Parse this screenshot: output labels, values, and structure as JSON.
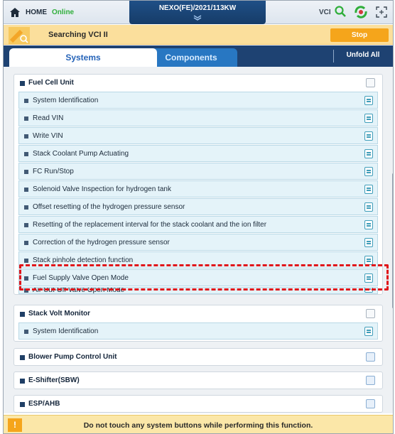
{
  "header": {
    "home_label": "HOME",
    "online_label": "Online",
    "vehicle_title": "NEXO(FE)/2021/113KW",
    "vci_label": "VCI"
  },
  "vci_bar": {
    "status": "Searching VCI II",
    "stop_label": "Stop"
  },
  "tabs": {
    "systems": "Systems",
    "components": "Components",
    "unfold_all": "Unfold All"
  },
  "groups": [
    {
      "title": "Fuel Cell Unit",
      "expanded": true,
      "items": [
        "System Identification",
        "Read VIN",
        "Write VIN",
        "Stack Coolant Pump Actuating",
        "FC Run/Stop",
        "Solenoid Valve Inspection for hydrogen tank",
        "Offset resetting of the hydrogen pressure sensor",
        "Resetting of the replacement interval for the stack coolant and the ion filter",
        "Correction of the hydrogen pressure sensor",
        "Stack pinhole detection function",
        "Fuel Supply Valve Open Mode",
        "Air Cut-Off Valve Open Mode"
      ]
    },
    {
      "title": "Stack Volt Monitor",
      "expanded": true,
      "items": [
        "System Identification"
      ]
    },
    {
      "title": "Blower Pump Control Unit",
      "expanded": false,
      "items": []
    },
    {
      "title": "E-Shifter(SBW)",
      "expanded": false,
      "items": []
    },
    {
      "title": "ESP/AHB",
      "expanded": false,
      "items": []
    }
  ],
  "footer": {
    "warning_icon": "!",
    "message": "Do not touch any system buttons while performing this function."
  },
  "colors": {
    "header_blue": "#1e4272",
    "accent_orange": "#f5a51b",
    "online_green": "#2fae3a",
    "highlight_red": "#e0161b"
  }
}
